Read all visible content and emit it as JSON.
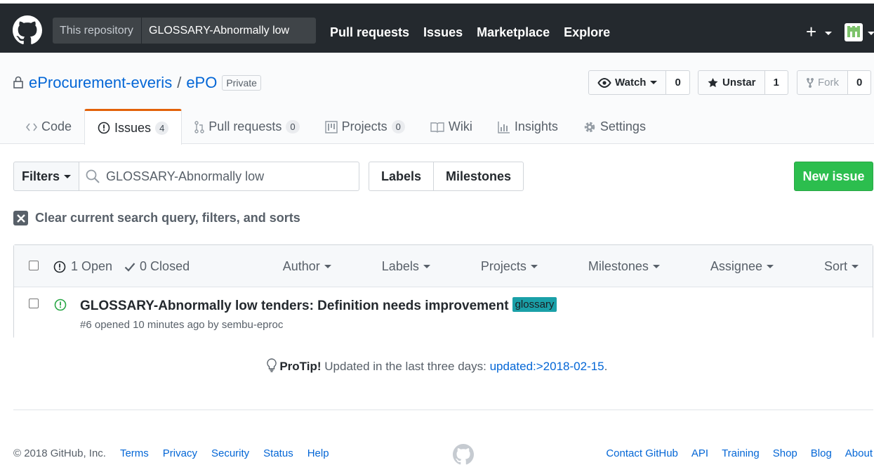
{
  "header": {
    "search_scope": "This repository",
    "search_value": "GLOSSARY-Abnormally low",
    "nav": [
      "Pull requests",
      "Issues",
      "Marketplace",
      "Explore"
    ],
    "plus": "+"
  },
  "repo": {
    "owner": "eProcurement-everis",
    "separator": "/",
    "name": "ePO",
    "visibility": "Private",
    "watch_label": "Watch",
    "watch_count": "0",
    "star_label": "Unstar",
    "star_count": "1",
    "fork_label": "Fork",
    "fork_count": "0"
  },
  "tabs": {
    "code": "Code",
    "issues": "Issues",
    "issues_count": "4",
    "pulls": "Pull requests",
    "pulls_count": "0",
    "projects": "Projects",
    "projects_count": "0",
    "wiki": "Wiki",
    "insights": "Insights",
    "settings": "Settings"
  },
  "toolbar": {
    "filters_label": "Filters",
    "filter_query": "GLOSSARY-Abnormally low",
    "labels_label": "Labels",
    "milestones_label": "Milestones",
    "new_issue_label": "New issue",
    "clear_label": "Clear current search query, filters, and sorts"
  },
  "list": {
    "open_label": "1 Open",
    "closed_label": "0 Closed",
    "sorts": {
      "author": "Author",
      "labels": "Labels",
      "projects": "Projects",
      "milestones": "Milestones",
      "assignee": "Assignee",
      "sort": "Sort"
    },
    "issues": [
      {
        "title": "GLOSSARY-Abnormally low tenders: Definition needs improvement",
        "label": "glossary",
        "meta": "#6 opened 10 minutes ago by sembu-eproc"
      }
    ]
  },
  "protip": {
    "bold": "ProTip!",
    "text": " Updated in the last three days: ",
    "link": "updated:>2018-02-15",
    "end": "."
  },
  "footer": {
    "copyright": "© 2018 GitHub, Inc.",
    "left_links": {
      "terms": "Terms",
      "privacy": "Privacy",
      "security": "Security",
      "status": "Status",
      "help": "Help"
    },
    "right_links": {
      "contact": "Contact GitHub",
      "api": "API",
      "training": "Training",
      "shop": "Shop",
      "blog": "Blog",
      "about": "About"
    }
  },
  "colors": {
    "header_bg": "#24292e",
    "accent": "#0366d6",
    "green": "#2cbe4e",
    "tab_border": "#e36209",
    "label_bg": "#1aa0a8"
  }
}
